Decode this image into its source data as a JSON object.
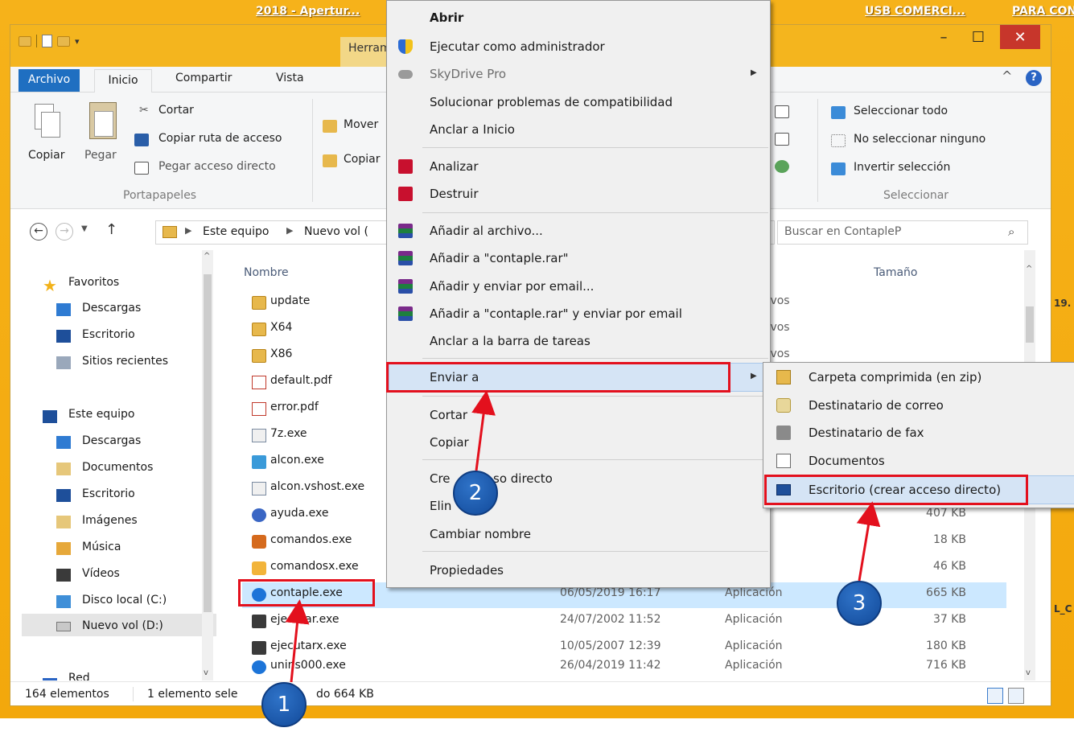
{
  "desktop": {
    "titles": [
      "2018 - Apertur...",
      "USB COMERCI...",
      "PARA CONT"
    ],
    "side_labels": [
      "19.",
      "L_C"
    ]
  },
  "window": {
    "contextual_tab": "Herram",
    "ribbon_tabs": {
      "file": "Archivo",
      "home": "Inicio",
      "share": "Compartir",
      "view": "Vista"
    },
    "clipboard": {
      "copy": "Copiar",
      "paste": "Pegar",
      "cut": "Cortar",
      "copy_path": "Copiar ruta de acceso",
      "paste_shortcut": "Pegar acceso directo",
      "group": "Portapapeles"
    },
    "organize": {
      "move": "Mover",
      "copy": "Copiar"
    },
    "select": {
      "select_all": "Seleccionar todo",
      "select_none": "No seleccionar ninguno",
      "invert": "Invertir selección",
      "group": "Seleccionar"
    },
    "address": {
      "this_pc": "Este equipo",
      "volume": "Nuevo vol ("
    },
    "search_placeholder": "Buscar en ContapleP",
    "nav": {
      "favorites": "Favoritos",
      "fav_items": [
        "Descargas",
        "Escritorio",
        "Sitios recientes"
      ],
      "this_pc": "Este equipo",
      "pc_items": [
        "Descargas",
        "Documentos",
        "Escritorio",
        "Imágenes",
        "Música",
        "Vídeos",
        "Disco local (C:)",
        "Nuevo vol (D:)"
      ],
      "network": "Red"
    },
    "columns": {
      "name": "Nombre",
      "size": "Tamaño"
    },
    "files": [
      {
        "name": "update",
        "date": "",
        "type": "de archivos",
        "size": ""
      },
      {
        "name": "X64",
        "date": "",
        "type": "de archivos",
        "size": ""
      },
      {
        "name": "X86",
        "date": "",
        "type": "de archivos",
        "size": ""
      },
      {
        "name": "default.pdf",
        "date": "",
        "type": "",
        "size": ""
      },
      {
        "name": "error.pdf",
        "date": "",
        "type": "",
        "size": ""
      },
      {
        "name": "7z.exe",
        "date": "",
        "type": "",
        "size": ""
      },
      {
        "name": "alcon.exe",
        "date": "",
        "type": "",
        "size": ""
      },
      {
        "name": "alcon.vshost.exe",
        "date": "",
        "type": "",
        "size": ""
      },
      {
        "name": "ayuda.exe",
        "date": "",
        "type": "ión",
        "size": "407 KB"
      },
      {
        "name": "comandos.exe",
        "date": "",
        "type": "ión",
        "size": "18 KB"
      },
      {
        "name": "comandosx.exe",
        "date": "",
        "type": "ión",
        "size": "46 KB"
      },
      {
        "name": "contaple.exe",
        "date": "06/05/2019 16:17",
        "type": "Aplicación",
        "size": "665 KB"
      },
      {
        "name": "ejecutar.exe",
        "date": "24/07/2002 11:52",
        "type": "Aplicación",
        "size": "37 KB"
      },
      {
        "name": "ejecutarx.exe",
        "date": "10/05/2007 12:39",
        "type": "Aplicación",
        "size": "180 KB"
      },
      {
        "name": "unins000.exe",
        "date": "26/04/2019 11:42",
        "type": "Aplicación",
        "size": "716 KB"
      }
    ],
    "status": {
      "count": "164 elementos",
      "selection": "1 elemento sele",
      "selection_tail": "do  664 KB"
    }
  },
  "context_menu": {
    "items": [
      {
        "label": "Abrir",
        "bold": true
      },
      {
        "label": "Ejecutar como administrador",
        "icon": "shield-icon"
      },
      {
        "label": "SkyDrive Pro",
        "icon": "cloud-icon",
        "disabled": true
      },
      {
        "label": "Solucionar problemas de compatibilidad"
      },
      {
        "label": "Anclar a Inicio"
      },
      {
        "label": "Analizar",
        "icon": "mcafee-icon"
      },
      {
        "label": "Destruir",
        "icon": "mcafee-icon"
      },
      {
        "label": "Añadir al archivo...",
        "icon": "winrar-icon"
      },
      {
        "label": "Añadir a \"contaple.rar\"",
        "icon": "winrar-icon"
      },
      {
        "label": "Añadir y enviar por email...",
        "icon": "winrar-icon"
      },
      {
        "label": "Añadir a \"contaple.rar\" y enviar por email",
        "icon": "winrar-icon"
      },
      {
        "label": "Anclar a la barra de tareas"
      },
      {
        "label": "Enviar a"
      },
      {
        "label": "Cortar"
      },
      {
        "label": "Copiar"
      },
      {
        "label": "Cre",
        "label_tail": "so directo"
      },
      {
        "label": "Elin"
      },
      {
        "label": "Cambiar nombre"
      },
      {
        "label": "Propiedades"
      }
    ]
  },
  "send_to_menu": {
    "items": [
      {
        "label": "Carpeta comprimida (en zip)"
      },
      {
        "label": "Destinatario de correo"
      },
      {
        "label": "Destinatario de fax"
      },
      {
        "label": "Documentos"
      },
      {
        "label": "Escritorio (crear acceso directo)"
      }
    ]
  },
  "annotations": {
    "step1": "1",
    "step2": "2",
    "step3": "3",
    "color": "#e3101d"
  }
}
